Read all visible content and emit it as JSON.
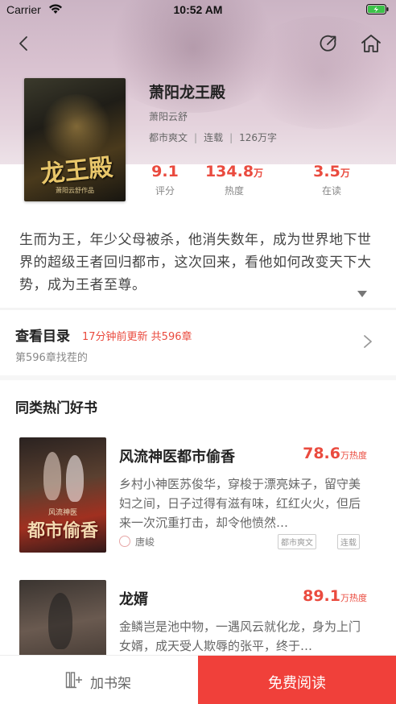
{
  "status_bar": {
    "carrier": "Carrier",
    "time": "10:52 AM"
  },
  "nav": {
    "back_icon": "back-icon",
    "share_icon": "share-icon",
    "home_icon": "home-icon"
  },
  "book": {
    "cover_title": "龙王殿",
    "cover_author": "萧阳云舒作品",
    "title": "萧阳龙王殿",
    "author": "萧阳云舒",
    "genre": "都市爽文",
    "status": "连载",
    "word_count": "126万字",
    "stats": [
      {
        "value": "9.1",
        "unit": "",
        "label": "评分"
      },
      {
        "value": "134.8",
        "unit": "万",
        "label": "热度"
      },
      {
        "value": "3.5",
        "unit": "万",
        "label": "在读"
      }
    ],
    "synopsis": "生而为王，年少父母被杀，他消失数年，成为世界地下世界的超级王者回归都市，这次回来，看他如何改变天下大势，成为王者至尊。"
  },
  "catalog": {
    "title": "查看目录",
    "update": "17分钟前更新 共596章",
    "latest": "第596章找茬的"
  },
  "recommend": {
    "section_title": "同类热门好书",
    "items": [
      {
        "title": "风流神医都市偷香",
        "heat_value": "78.6",
        "heat_unit": "万热度",
        "desc": "乡村小神医苏俊华，穿梭于漂亮妹子，留守美妇之间，日子过得有滋有味，红红火火，但后来一次沉重打击，却令他愤然…",
        "author": "唐峻",
        "tags": [
          "都市爽文",
          "连载"
        ],
        "cover_text": "都市偷香",
        "cover_sub": "风流神医"
      },
      {
        "title": "龙婿",
        "heat_value": "89.1",
        "heat_unit": "万热度",
        "desc": "金鳞岂是池中物，一遇风云就化龙，身为上门女婿，成天受人欺辱的张平，终于…"
      }
    ]
  },
  "bottom_bar": {
    "add_shelf": "加书架",
    "read_free": "免费阅读"
  },
  "colors": {
    "accent": "#ea4b3f",
    "button": "#f0403a"
  }
}
